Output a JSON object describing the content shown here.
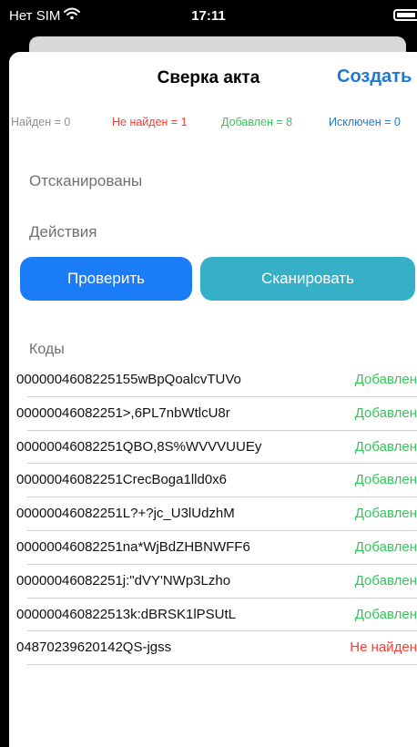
{
  "status_bar": {
    "carrier": "Нет SIM",
    "time": "17:11"
  },
  "header": {
    "title": "Сверка акта",
    "create_label": "Создать"
  },
  "stats": {
    "found": "Найден = 0",
    "not_found": "Не найден = 1",
    "added": "Добавлен = 8",
    "excluded": "Исключен = 0"
  },
  "sections": {
    "scanned": "Отсканированы",
    "actions": "Действия",
    "codes": "Коды"
  },
  "buttons": {
    "check": "Проверить",
    "scan": "Сканировать"
  },
  "codes": [
    {
      "code": "0000004608225155wBpQoalcvTUVo",
      "status": "Добавлен",
      "color": "#34c759"
    },
    {
      "code": "00000046082251>,6PL7nbWtlcU8r",
      "status": "Добавлен",
      "color": "#34c759"
    },
    {
      "code": "00000046082251QBO,8S%WVVVUUEy",
      "status": "Добавлен",
      "color": "#34c759"
    },
    {
      "code": "00000046082251CrecBoga1lld0x6",
      "status": "Добавлен",
      "color": "#34c759"
    },
    {
      "code": "00000046082251L?+?jc_U3lUdzhM",
      "status": "Добавлен",
      "color": "#34c759"
    },
    {
      "code": "00000046082251na*WjBdZHBNWFF6",
      "status": "Добавлен",
      "color": "#34c759"
    },
    {
      "code": "00000046082251j:\"dVY'NWp3Lzho",
      "status": "Добавлен",
      "color": "#34c759"
    },
    {
      "code": "000000460822513k:dBRSK1lPSUtL",
      "status": "Добавлен",
      "color": "#34c759"
    },
    {
      "code": "04870239620142QS-jgss",
      "status": "Не найден",
      "color": "#ff3b30"
    }
  ],
  "colors": {
    "found": "#8e8e93",
    "not_found": "#ff3b30",
    "added": "#34c759",
    "excluded": "#1f78d1"
  }
}
